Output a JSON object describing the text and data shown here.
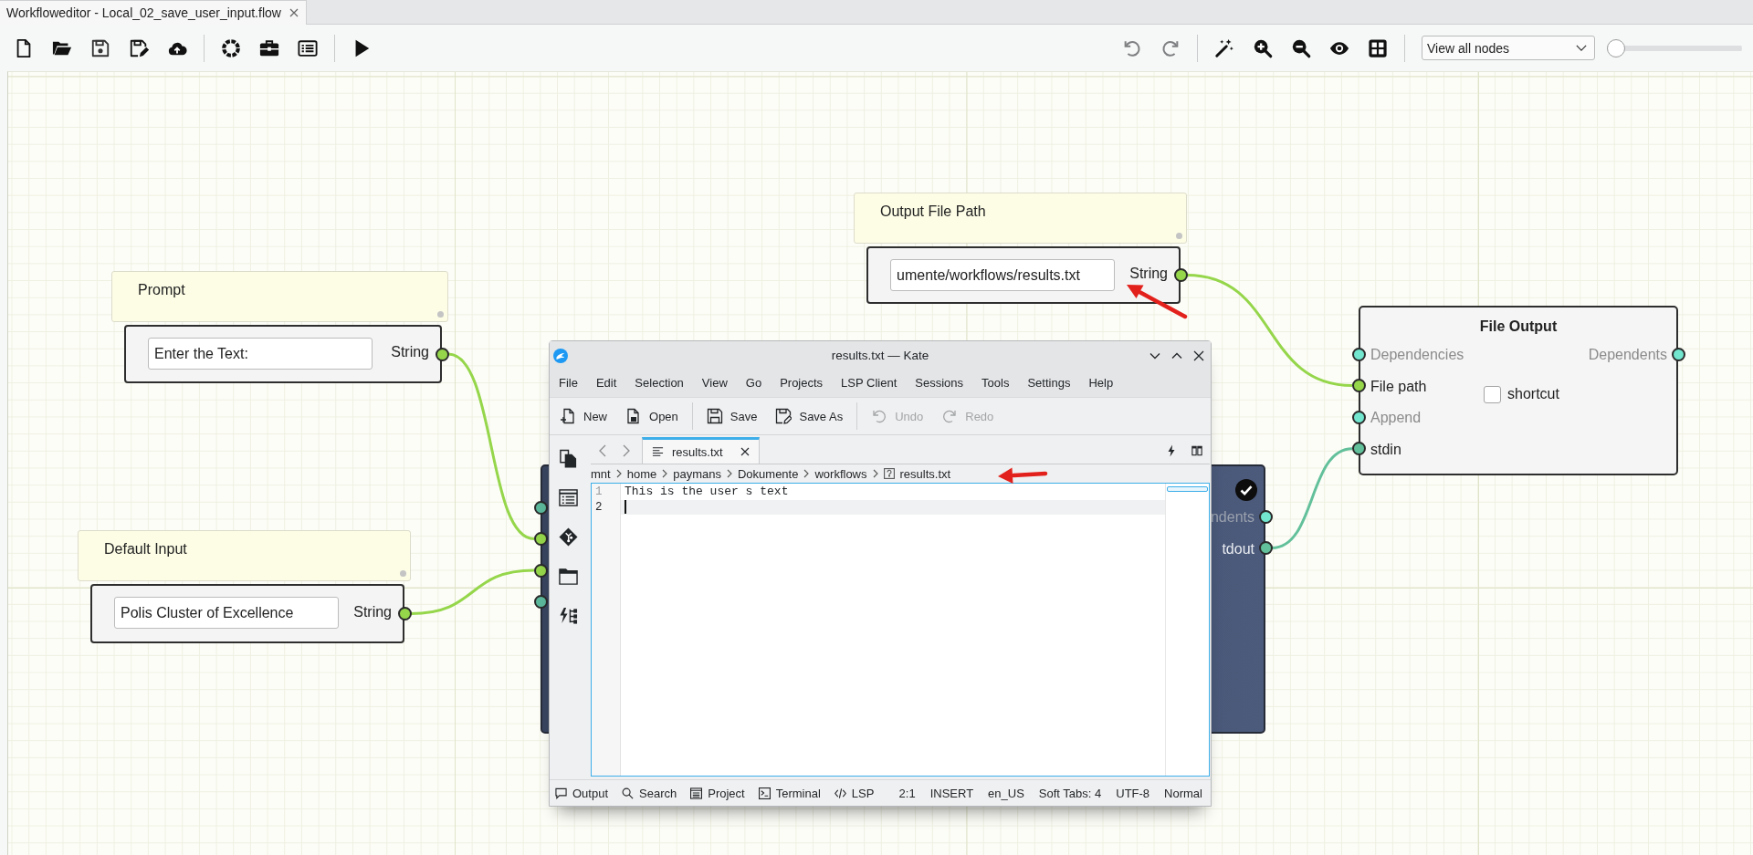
{
  "window": {
    "tabs": [
      {
        "label": "Workfloweditor - Local_02_save_user_input.flow",
        "selected": true
      }
    ]
  },
  "toolbar": {
    "undo": {
      "disabled": true
    },
    "redo": {
      "disabled": true
    },
    "view_select": {
      "value": "View all nodes"
    },
    "zoom_slider": {
      "level": 0
    }
  },
  "canvas": {
    "nodes": [
      {
        "kind": "value",
        "selected": false,
        "comment": "Output File Path",
        "value": "umente/workflows/results.txt",
        "outputs": [
          {
            "label": "String",
            "color": "#95d64b",
            "connected": true
          }
        ]
      },
      {
        "kind": "value",
        "selected": false,
        "comment": "Prompt",
        "value": "Enter the Text:",
        "outputs": [
          {
            "label": "String",
            "color": "#95d64b",
            "connected": true
          }
        ]
      },
      {
        "kind": "process",
        "selected": false,
        "title": "File Output",
        "inputs": [
          {
            "label": "Dependencies",
            "color": "#72e6cf",
            "connected": false
          },
          {
            "label": "File path",
            "color": "#95d64b",
            "connected": true
          },
          {
            "label": "Append",
            "color": "#72e6cf",
            "connected": false
          },
          {
            "label": "stdin",
            "color": "#62c09a",
            "connected": true
          }
        ],
        "outputs": [
          {
            "label": "Dependents",
            "color": "#72e6cf",
            "connected": false
          }
        ],
        "options": [
          {
            "label": "shortcut",
            "checked": false
          }
        ]
      },
      {
        "kind": "process",
        "selected": true,
        "completed": true,
        "inputs": [
          {
            "color": "#5cb89b"
          },
          {
            "color": "#95d64b"
          },
          {
            "color": "#95d64b"
          },
          {
            "color": "#5cb89b"
          }
        ],
        "outputs": [
          {
            "label": "ndents",
            "color": "#72e6cf",
            "connected": false
          },
          {
            "label": "tdout",
            "color": "#62c09a",
            "connected": true
          }
        ]
      },
      {
        "kind": "value",
        "selected": false,
        "comment": "Default Input",
        "value": "Polis Cluster of Excellence",
        "outputs": [
          {
            "label": "String",
            "color": "#95d64b",
            "connected": true
          }
        ]
      }
    ]
  },
  "editor_window": {
    "title": "results.txt — Kate",
    "menu": [
      "File",
      "Edit",
      "Selection",
      "View",
      "Go",
      "Projects",
      "LSP Client",
      "Sessions",
      "Tools",
      "Settings",
      "Help"
    ],
    "toolbar": [
      {
        "label": "New",
        "disabled": false
      },
      {
        "label": "Open",
        "disabled": false
      },
      {
        "label": "Save",
        "disabled": false
      },
      {
        "label": "Save As",
        "disabled": false
      },
      {
        "label": "Undo",
        "disabled": true
      },
      {
        "label": "Redo",
        "disabled": true
      }
    ],
    "tabs": [
      {
        "label": "results.txt",
        "selected": true
      }
    ],
    "breadcrumb": [
      "mnt",
      "home",
      "paymans",
      "Dokumente",
      "workflows",
      "results.txt"
    ],
    "lines": [
      {
        "number": "1",
        "text": "This is the user s text",
        "current": false
      },
      {
        "number": "2",
        "current": true
      }
    ],
    "status_bar": {
      "panels": [
        "Output",
        "Search",
        "Project",
        "Terminal",
        "LSP"
      ],
      "fields": [
        "2:1",
        "INSERT",
        "en_US",
        "Soft Tabs: 4",
        "UTF-8",
        "Normal"
      ]
    }
  }
}
